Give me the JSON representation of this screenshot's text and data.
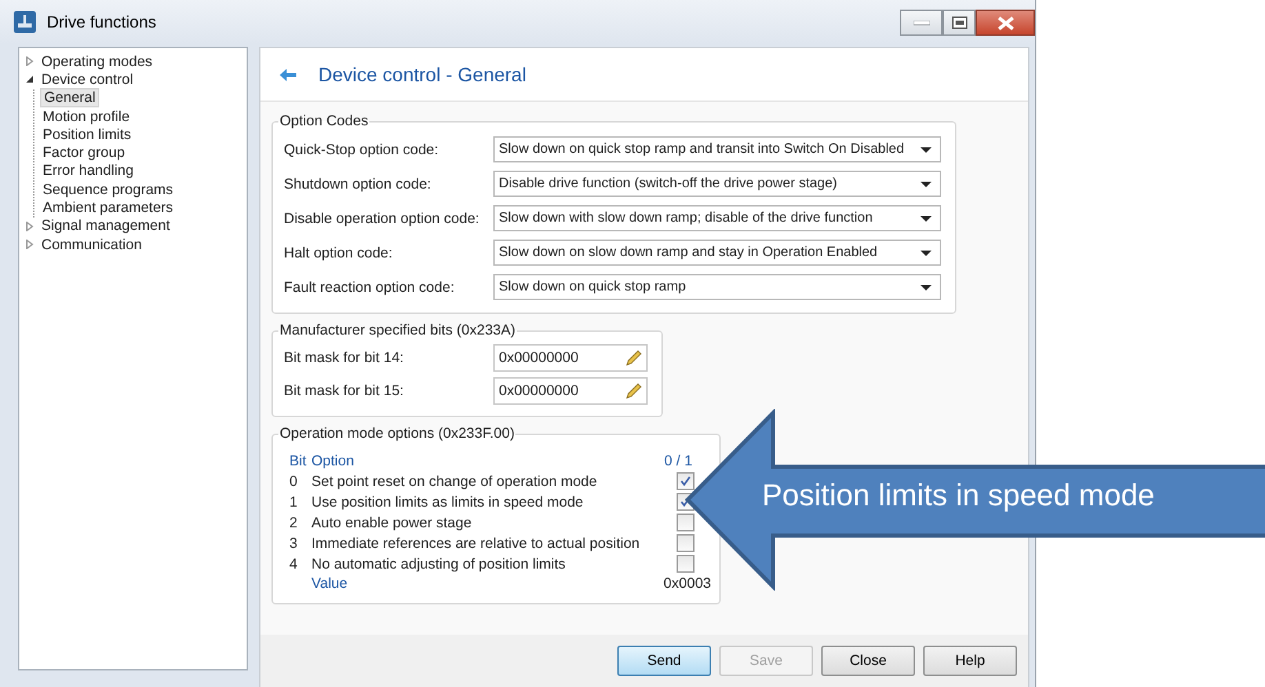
{
  "window": {
    "title": "Drive functions"
  },
  "tree": [
    {
      "label": "Operating modes",
      "expanded": false,
      "selected": false
    },
    {
      "label": "Device control",
      "expanded": true,
      "selected": false,
      "children": [
        {
          "label": "General",
          "selected": true
        },
        {
          "label": "Motion profile",
          "selected": false
        },
        {
          "label": "Position limits",
          "selected": false
        },
        {
          "label": "Factor group",
          "selected": false
        },
        {
          "label": "Error handling",
          "selected": false
        },
        {
          "label": "Sequence programs",
          "selected": false
        },
        {
          "label": "Ambient parameters",
          "selected": false
        }
      ]
    },
    {
      "label": "Signal management",
      "expanded": false,
      "selected": false
    },
    {
      "label": "Communication",
      "expanded": false,
      "selected": false
    }
  ],
  "page": {
    "title": "Device control - General"
  },
  "option_codes": {
    "title": "Option Codes",
    "rows": [
      {
        "label": "Quick-Stop option code:",
        "value": "Slow down on quick stop ramp and transit into Switch On Disabled"
      },
      {
        "label": "Shutdown option code:",
        "value": "Disable drive function (switch-off the drive power stage)"
      },
      {
        "label": "Disable operation option code:",
        "value": "Slow down with slow down ramp; disable of the drive function"
      },
      {
        "label": "Halt option code:",
        "value": "Slow down on slow down ramp and stay in Operation Enabled"
      },
      {
        "label": "Fault reaction option code:",
        "value": "Slow down on quick stop ramp"
      }
    ]
  },
  "manufacturer_bits": {
    "title": "Manufacturer specified bits (0x233A)",
    "rows": [
      {
        "label": "Bit mask for bit 14:",
        "value": "0x00000000"
      },
      {
        "label": "Bit mask for bit 15:",
        "value": "0x00000000"
      }
    ]
  },
  "operation_mode_options": {
    "title": "Operation mode options (0x233F.00)",
    "header": {
      "bit": "Bit",
      "option": "Option",
      "state": "0 / 1"
    },
    "rows": [
      {
        "bit": "0",
        "option": "Set point reset on change of operation mode",
        "checked": true
      },
      {
        "bit": "1",
        "option": "Use position limits as limits in speed mode",
        "checked": true
      },
      {
        "bit": "2",
        "option": "Auto enable power stage",
        "checked": false
      },
      {
        "bit": "3",
        "option": "Immediate references are relative to actual position",
        "checked": false
      },
      {
        "bit": "4",
        "option": "No automatic adjusting of position limits",
        "checked": false
      }
    ],
    "value_label": "Value",
    "value": "0x0003"
  },
  "buttons": [
    {
      "label": "Send",
      "default": true,
      "disabled": false
    },
    {
      "label": "Save",
      "default": false,
      "disabled": true
    },
    {
      "label": "Close",
      "default": false,
      "disabled": false
    },
    {
      "label": "Help",
      "default": false,
      "disabled": false
    }
  ],
  "callout": {
    "text": "Position limits in speed mode"
  }
}
